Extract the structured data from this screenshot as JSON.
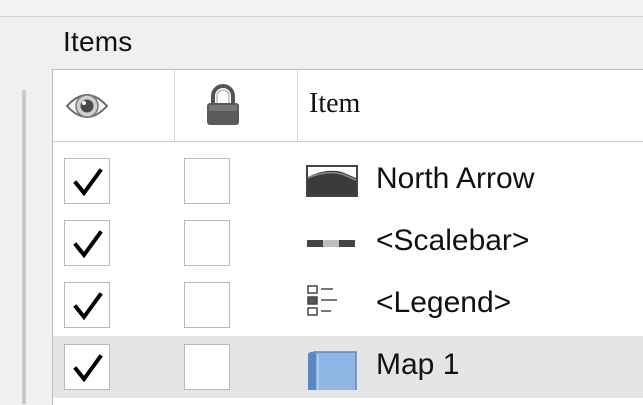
{
  "panel": {
    "title": "Items",
    "columns": {
      "visibility_icon": "eye-icon",
      "lock_icon": "padlock-icon",
      "item_label": "Item"
    }
  },
  "items": [
    {
      "label": "North Arrow",
      "icon": "picture-item-icon",
      "visible": true,
      "locked": false,
      "selected": false
    },
    {
      "label": "<Scalebar>",
      "icon": "scalebar-item-icon",
      "visible": true,
      "locked": false,
      "selected": false
    },
    {
      "label": "<Legend>",
      "icon": "legend-item-icon",
      "visible": true,
      "locked": false,
      "selected": false
    },
    {
      "label": "Map 1",
      "icon": "map-item-icon",
      "visible": true,
      "locked": false,
      "selected": true
    }
  ],
  "colors": {
    "panel_bg": "#f0f0f0",
    "table_bg": "#ffffff",
    "selected_row": "#e5e5e5",
    "text": "#111111"
  }
}
